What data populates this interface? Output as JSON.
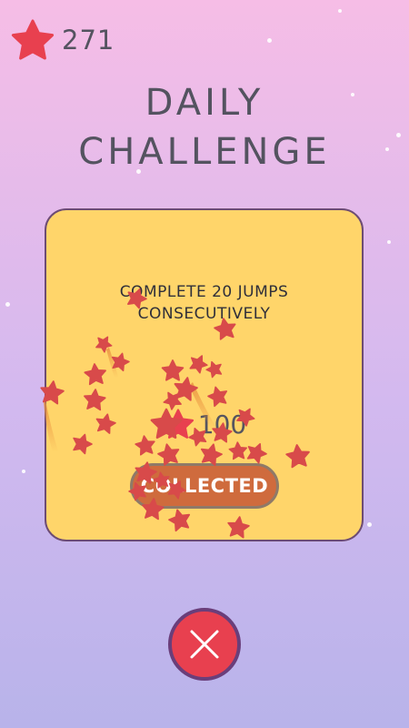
{
  "hud": {
    "star_count": "271",
    "star_icon": "star-icon"
  },
  "title": {
    "line1": "DAILY",
    "line2": "CHALLENGE"
  },
  "challenge": {
    "task_line1": "COMPLETE 20 JUMPS",
    "task_line2": "CONSECUTIVELY",
    "reward_amount": "100",
    "reward_icon": "star-icon",
    "button_label": "COLLECTED"
  },
  "close_button": {
    "icon": "close-icon"
  },
  "colors": {
    "background_top": "#f6bde6",
    "background_bottom": "#b8b3ea",
    "card": "#ffd56a",
    "star": "#e8404f",
    "button": "#cf6b3d",
    "close_button": "#e8404f",
    "text": "#545360"
  }
}
